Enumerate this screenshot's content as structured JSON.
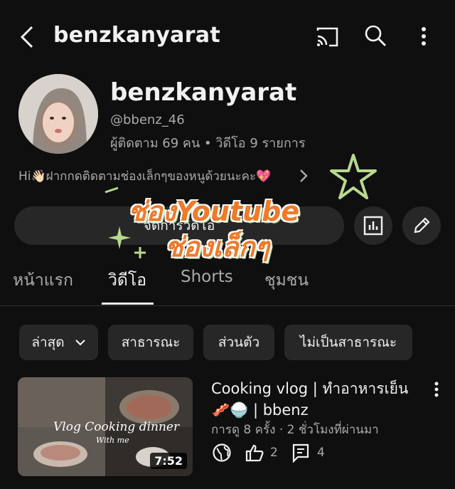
{
  "header": {
    "title": "benzkanyarat"
  },
  "channel": {
    "name": "benzkanyarat",
    "handle": "@bbenz_46",
    "stats": "ผู้ติดตาม 69 คน • วิดีโอ 9 รายการ",
    "description": "Hi👋🏻ฝากกดติดตามช่องเล็กๆของหนูด้วยนะคะ💖",
    "manage_label": "จัดการวิดีโอ"
  },
  "sticker": {
    "line1": "ช่องYoutube",
    "line2": "ช่องเล็กๆ"
  },
  "tabs": [
    {
      "label": "หน้าแรก"
    },
    {
      "label": "วิดีโอ"
    },
    {
      "label": "Shorts"
    },
    {
      "label": "ชุมชน"
    }
  ],
  "filters": {
    "sort_label": "ล่าสุด",
    "chips": [
      {
        "label": "สาธารณะ"
      },
      {
        "label": "ส่วนตัว"
      },
      {
        "label": "ไม่เป็นสาธารณะ"
      }
    ]
  },
  "videos": [
    {
      "title": "Cooking vlog | ทำอาหารเย็น🥓🍚 | bbenz",
      "meta": "การดู 8 ครั้ง · 2 ชั่วโมงที่ผ่านมา",
      "duration": "7:52",
      "thumb_text": "Vlog Cooking dinner",
      "thumb_sub": "With me",
      "likes": "2",
      "comments": "4"
    }
  ],
  "colors": {
    "background": "#0f0f0f",
    "surface": "#272727",
    "text": "#f1f1f1",
    "muted": "#aaaaaa",
    "sticker": "#f07a2a",
    "sticker_star": "#b9d98f"
  }
}
